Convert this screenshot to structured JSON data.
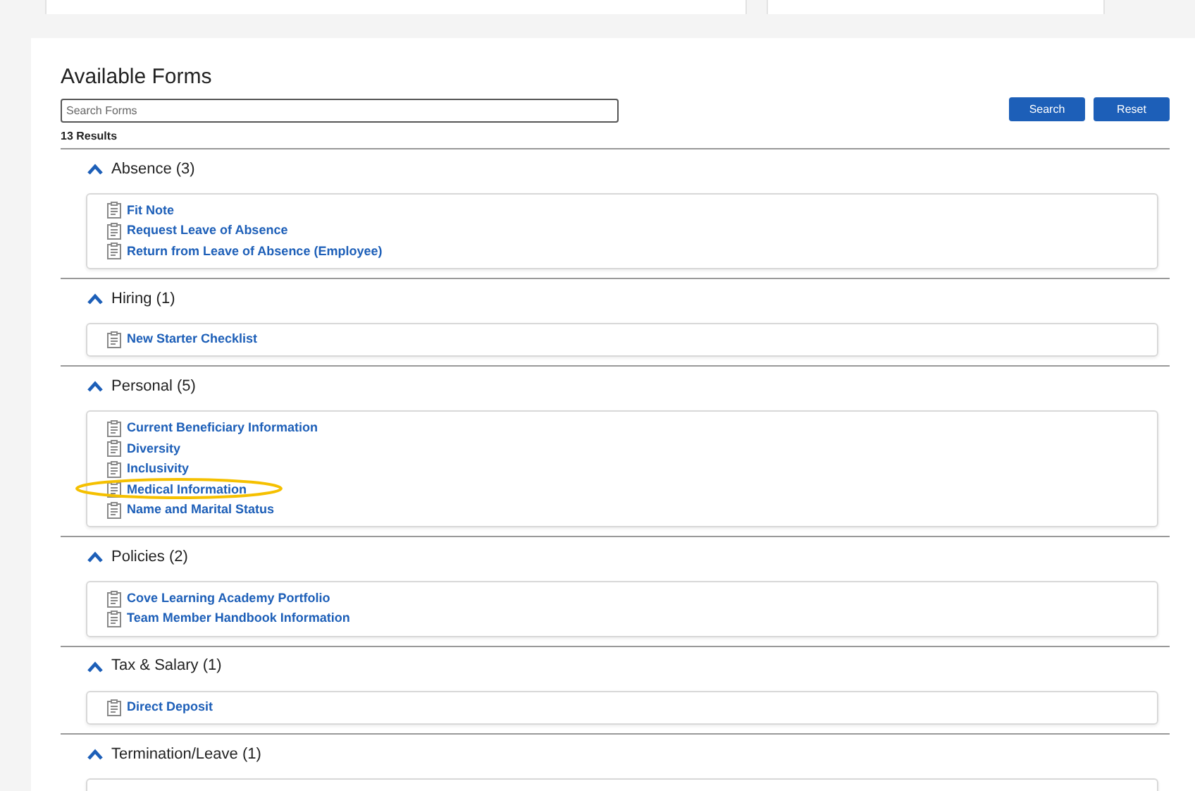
{
  "title": "Available Forms",
  "search": {
    "placeholder": "Search Forms"
  },
  "buttons": [
    "Search",
    "Reset"
  ],
  "results": "13 Results",
  "sections": [
    {
      "name": "Absence",
      "count": "(3)",
      "expanded": true,
      "items": [
        "Fit Note",
        "Request Leave of Absence",
        "Return from Leave of Absence (Employee)"
      ]
    },
    {
      "name": "Hiring",
      "count": "(1)",
      "expanded": true,
      "items": [
        "New Starter Checklist"
      ]
    },
    {
      "name": "Personal",
      "count": "(5)",
      "expanded": true,
      "items": [
        "Current Beneficiary Information",
        "Diversity",
        "Inclusivity",
        "Medical Information",
        "Name and Marital Status"
      ]
    },
    {
      "name": "Policies",
      "count": "(2)",
      "expanded": true,
      "items": [
        "Cove Learning Academy Portfolio",
        "Team Member Handbook Information"
      ]
    },
    {
      "name": "Tax & Salary",
      "count": "(1)",
      "expanded": true,
      "items": [
        "Direct Deposit"
      ]
    },
    {
      "name": "Termination/Leave",
      "count": "(1)",
      "expanded": true
    }
  ]
}
